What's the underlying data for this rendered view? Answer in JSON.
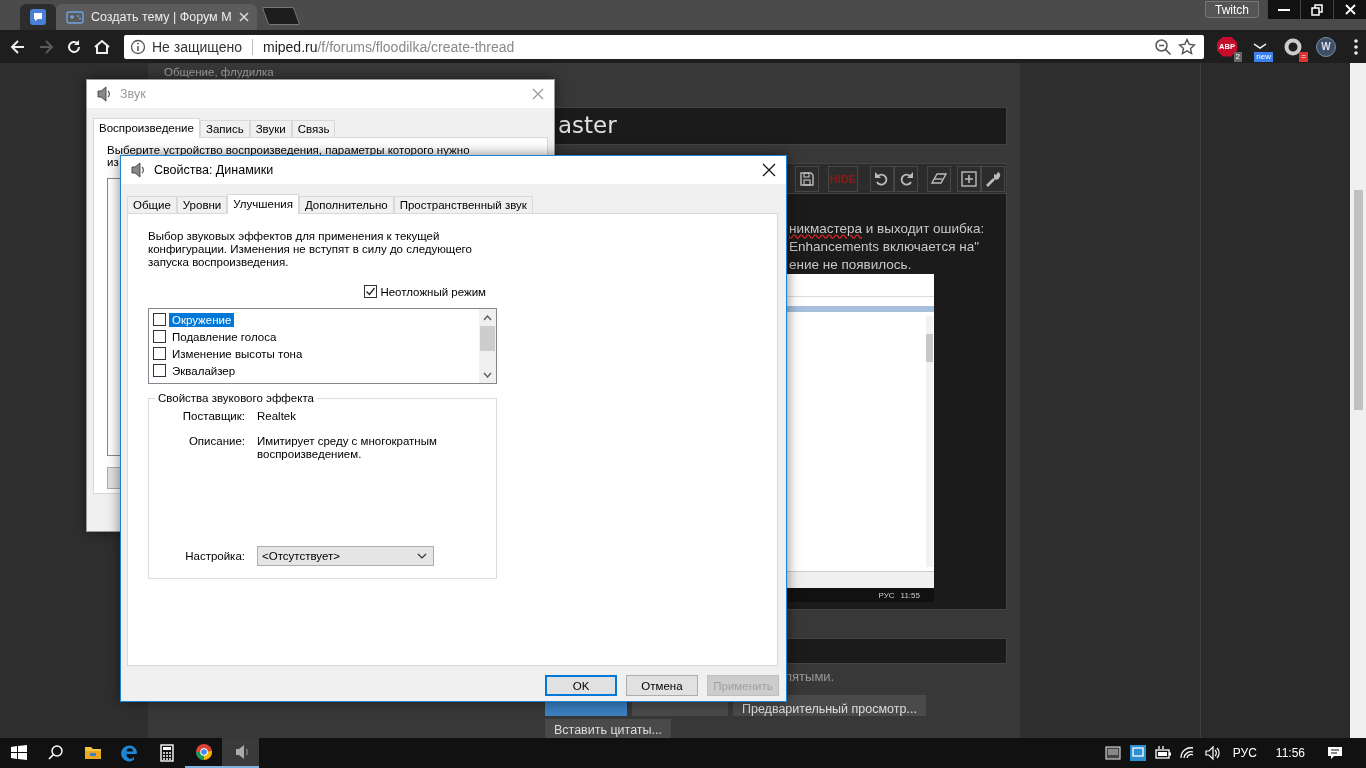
{
  "browser": {
    "tabs": [
      {
        "kind": "pinned",
        "selected": false
      },
      {
        "kind": "page",
        "title": "Создать тему | Форум M",
        "selected": true
      }
    ],
    "profile_button": "Twitch",
    "nav_buttons": [
      {
        "kind": "back",
        "disabled": false
      },
      {
        "kind": "forward",
        "disabled": true
      },
      {
        "kind": "reload",
        "disabled": false
      },
      {
        "kind": "home",
        "disabled": false
      }
    ],
    "security_label": "Не защищено",
    "url_host": "miped.ru",
    "url_path": "/f/forums/floodilka/create-thread",
    "extensions": [
      {
        "kind": "abp",
        "label": "ABP",
        "badge": "2"
      },
      {
        "kind": "mail",
        "badge": "new"
      },
      {
        "kind": "ring",
        "badge": "="
      },
      {
        "kind": "shield",
        "label": "W"
      }
    ]
  },
  "page": {
    "breadcrumb": "Общение, флудилка",
    "title_fragment": "aster",
    "editor_toolbar": [
      {
        "kind": "save"
      },
      {
        "kind": "hide",
        "label": "HIDE"
      },
      {
        "kind": "undo"
      },
      {
        "kind": "redo"
      },
      {
        "kind": "eraser"
      },
      {
        "kind": "insert"
      },
      {
        "kind": "settings"
      }
    ],
    "editor_lines": [
      [
        {
          "text": "никмастера",
          "misspelled": true
        },
        {
          "text": " и выходит ошибка:",
          "misspelled": false
        }
      ],
      [
        {
          "text": "Enhancements включается на\"",
          "misspelled": false
        }
      ],
      [
        {
          "text": "ение не появилось.",
          "misspelled": false
        }
      ]
    ],
    "screenshot": {
      "tray_texts": [
        "РУС",
        "11:55"
      ]
    },
    "hint_fragment": "пятыми.",
    "buttons": [
      {
        "kind": "primary"
      },
      {
        "kind": "secondary"
      },
      {
        "label": "Предварительный просмотр...",
        "kind": "secondary"
      },
      {
        "label": "Вставить цитаты...",
        "kind": "secondary"
      }
    ]
  },
  "sound_window": {
    "title": "Звук",
    "tabs": [
      {
        "label": "Воспроизведение",
        "selected": true
      },
      {
        "label": "Запись",
        "selected": false
      },
      {
        "label": "Звуки",
        "selected": false
      },
      {
        "label": "Связь",
        "selected": false
      }
    ],
    "prompt_lines": [
      "Выберите устройство воспроизведения, параметры которого нужно",
      "из"
    ],
    "partial_button": true
  },
  "properties_dialog": {
    "title": "Свойства: Динамики",
    "tabs": [
      {
        "label": "Общие",
        "selected": false
      },
      {
        "label": "Уровни",
        "selected": false
      },
      {
        "label": "Улучшения",
        "selected": true
      },
      {
        "label": "Дополнительно",
        "selected": false
      },
      {
        "label": "Пространственный звук",
        "selected": false
      }
    ],
    "description": "Выбор звуковых эффектов для применения к текущей конфигурации. Изменения не вступят в силу до следующего запуска воспроизведения.",
    "immediate_mode": {
      "label": "Неотложный режим",
      "checked": true
    },
    "effects": [
      {
        "label": "Окружение",
        "checked": false,
        "selected": true
      },
      {
        "label": "Подавление голоса",
        "checked": false,
        "selected": false
      },
      {
        "label": "Изменение высоты тона",
        "checked": false,
        "selected": false
      },
      {
        "label": "Эквалайзер",
        "checked": false,
        "selected": false
      }
    ],
    "effect_properties": {
      "title": "Свойства звукового эффекта",
      "rows": [
        {
          "label": "Поставщик:",
          "value": "Realtek"
        },
        {
          "label": "Описание:",
          "value": "Имитирует среду с многократным воспроизведением."
        }
      ],
      "setting_label": "Настройка:",
      "setting_value": "<Отсутствует>"
    },
    "buttons": [
      {
        "label": "OK",
        "kind": "default",
        "disabled": false
      },
      {
        "label": "Отмена",
        "kind": "normal",
        "disabled": false
      },
      {
        "label": "Применить",
        "kind": "normal",
        "disabled": true
      }
    ]
  },
  "taskbar": {
    "apps": [
      {
        "kind": "start",
        "running": false,
        "active": false
      },
      {
        "kind": "search",
        "running": false,
        "active": false
      },
      {
        "kind": "explorer",
        "running": false,
        "active": false
      },
      {
        "kind": "edge",
        "running": false,
        "active": false
      },
      {
        "kind": "calculator",
        "running": false,
        "active": false
      },
      {
        "kind": "chrome",
        "running": true,
        "active": false
      },
      {
        "kind": "sound",
        "running": true,
        "active": true
      }
    ],
    "tray": [
      {
        "kind": "device"
      },
      {
        "kind": "network-app"
      },
      {
        "kind": "battery"
      },
      {
        "kind": "wifi"
      },
      {
        "kind": "volume"
      }
    ],
    "language": "РУС",
    "time": "11:56"
  }
}
